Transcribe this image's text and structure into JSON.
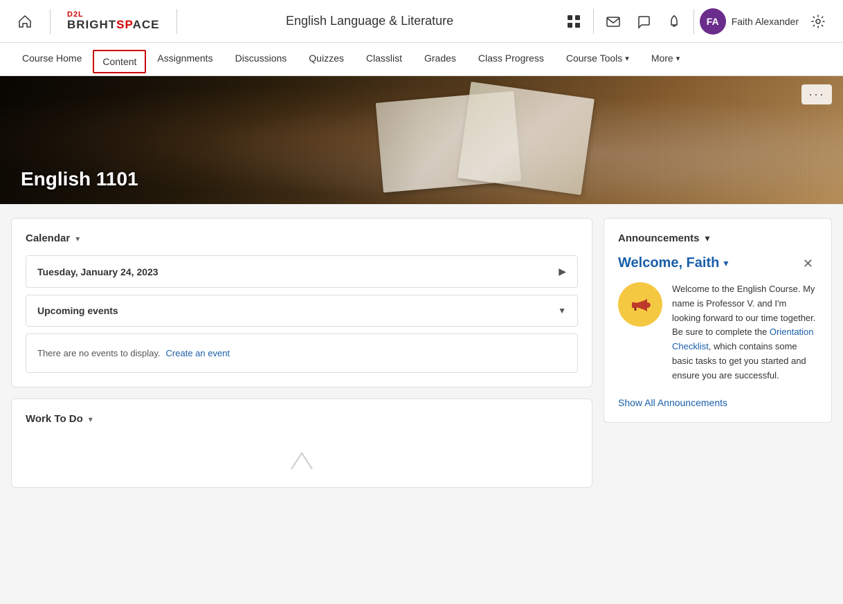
{
  "header": {
    "home_icon": "⌂",
    "logo_d2l": "D2L",
    "logo_brightspace_plain": "BRIGHT",
    "logo_brightspace_accent": "SP",
    "logo_brightspace_rest": "ACE",
    "course_title": "English Language & Literature",
    "icons": {
      "grid": "⊞",
      "mail": "✉",
      "chat": "💬",
      "bell": "🔔",
      "settings": "⚙"
    },
    "avatar_initials": "FA",
    "user_name": "Faith Alexander"
  },
  "nav": {
    "items": [
      {
        "id": "course-home",
        "label": "Course Home",
        "active": false,
        "boxed": false
      },
      {
        "id": "content",
        "label": "Content",
        "active": true,
        "boxed": true
      },
      {
        "id": "assignments",
        "label": "Assignments",
        "active": false,
        "boxed": false
      },
      {
        "id": "discussions",
        "label": "Discussions",
        "active": false,
        "boxed": false
      },
      {
        "id": "quizzes",
        "label": "Quizzes",
        "active": false,
        "boxed": false
      },
      {
        "id": "classlist",
        "label": "Classlist",
        "active": false,
        "boxed": false
      },
      {
        "id": "grades",
        "label": "Grades",
        "active": false,
        "boxed": false
      },
      {
        "id": "class-progress",
        "label": "Class Progress",
        "active": false,
        "boxed": false
      },
      {
        "id": "course-tools",
        "label": "Course Tools",
        "active": false,
        "boxed": false,
        "has_chevron": true
      },
      {
        "id": "more",
        "label": "More",
        "active": false,
        "boxed": false,
        "has_chevron": true
      }
    ]
  },
  "hero": {
    "course_name": "English 1101",
    "menu_dots": "···"
  },
  "calendar": {
    "title": "Calendar",
    "date_label": "Tuesday, January 24, 2023",
    "upcoming_label": "Upcoming events",
    "no_events_text": "There are no events to display.",
    "create_event_label": "Create an event"
  },
  "work_todo": {
    "title": "Work To Do"
  },
  "announcements": {
    "title": "Announcements",
    "welcome_title": "Welcome, Faith",
    "body_text_1": "Welcome to the English Course. My name is Professor V. and I'm looking forward to our time together. Be sure to complete the ",
    "link_text": "Orientation Checklist",
    "body_text_2": ", which contains some basic tasks to get you started and ensure you are successful.",
    "show_all_label": "Show All Announcements"
  }
}
